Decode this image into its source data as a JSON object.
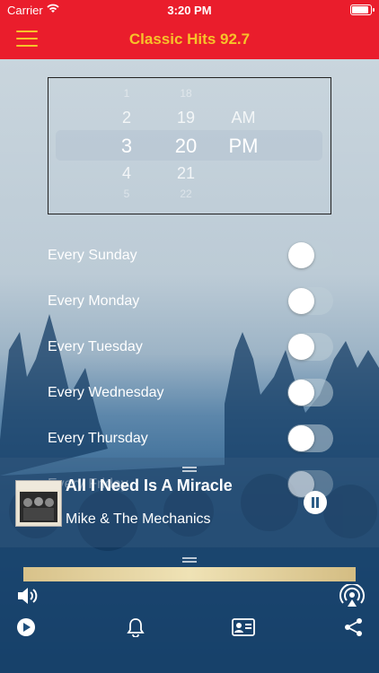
{
  "status": {
    "carrier": "Carrier",
    "time": "3:20 PM"
  },
  "nav": {
    "title": "Classic Hits 92.7"
  },
  "picker": {
    "hours": [
      "1",
      "2",
      "3",
      "4",
      "5"
    ],
    "minutes": [
      "18",
      "19",
      "20",
      "21",
      "22"
    ],
    "ampm": [
      "AM",
      "PM"
    ]
  },
  "days": [
    {
      "label": "Every Sunday",
      "on": false
    },
    {
      "label": "Every Monday",
      "on": false
    },
    {
      "label": "Every Tuesday",
      "on": false
    },
    {
      "label": "Every Wednesday",
      "on": false
    },
    {
      "label": "Every Thursday",
      "on": false
    },
    {
      "label": "Every Friday",
      "on": false
    }
  ],
  "player": {
    "title": "All I Need Is A Miracle",
    "artist": "Mike & The Mechanics",
    "state": "playing"
  },
  "icons": [
    "menu-icon",
    "volume-icon",
    "airplay-icon",
    "play-icon",
    "bell-icon",
    "contact-card-icon",
    "share-icon",
    "pause-icon"
  ],
  "colors": {
    "brand": "#ea1d2c",
    "accent": "#f7c22a"
  }
}
